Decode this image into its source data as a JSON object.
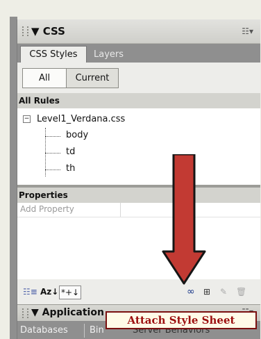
{
  "css_panel": {
    "title": "▼ CSS",
    "menu_icon": "panel-options-icon",
    "tabs": [
      {
        "label": "CSS Styles",
        "active": true
      },
      {
        "label": "Layers",
        "active": false
      }
    ],
    "mode_buttons": {
      "all": "All",
      "current": "Current"
    },
    "all_rules": {
      "heading": "All Rules",
      "stylesheet": "Level1_Verdana.css",
      "collapse_symbol": "−",
      "rules": [
        "body",
        "td",
        "th"
      ]
    },
    "properties": {
      "heading": "Properties",
      "placeholder": "Add Property"
    },
    "toolbar": {
      "show_category": "☷≡",
      "alpha_sort": "Az↓",
      "show_set": "*+↓",
      "attach_icon": "attach-style-sheet-icon",
      "attach_glyph": "∞",
      "new_rule_glyph": "⊞",
      "edit_glyph": "✎",
      "delete_glyph": "🗑"
    }
  },
  "application_panel": {
    "title": "▼ Application",
    "tabs": [
      "Databases",
      "Bin",
      "Server Behaviors"
    ]
  },
  "callout": {
    "text": "Attach Style Sheet",
    "accent_color": "#c23a33"
  }
}
